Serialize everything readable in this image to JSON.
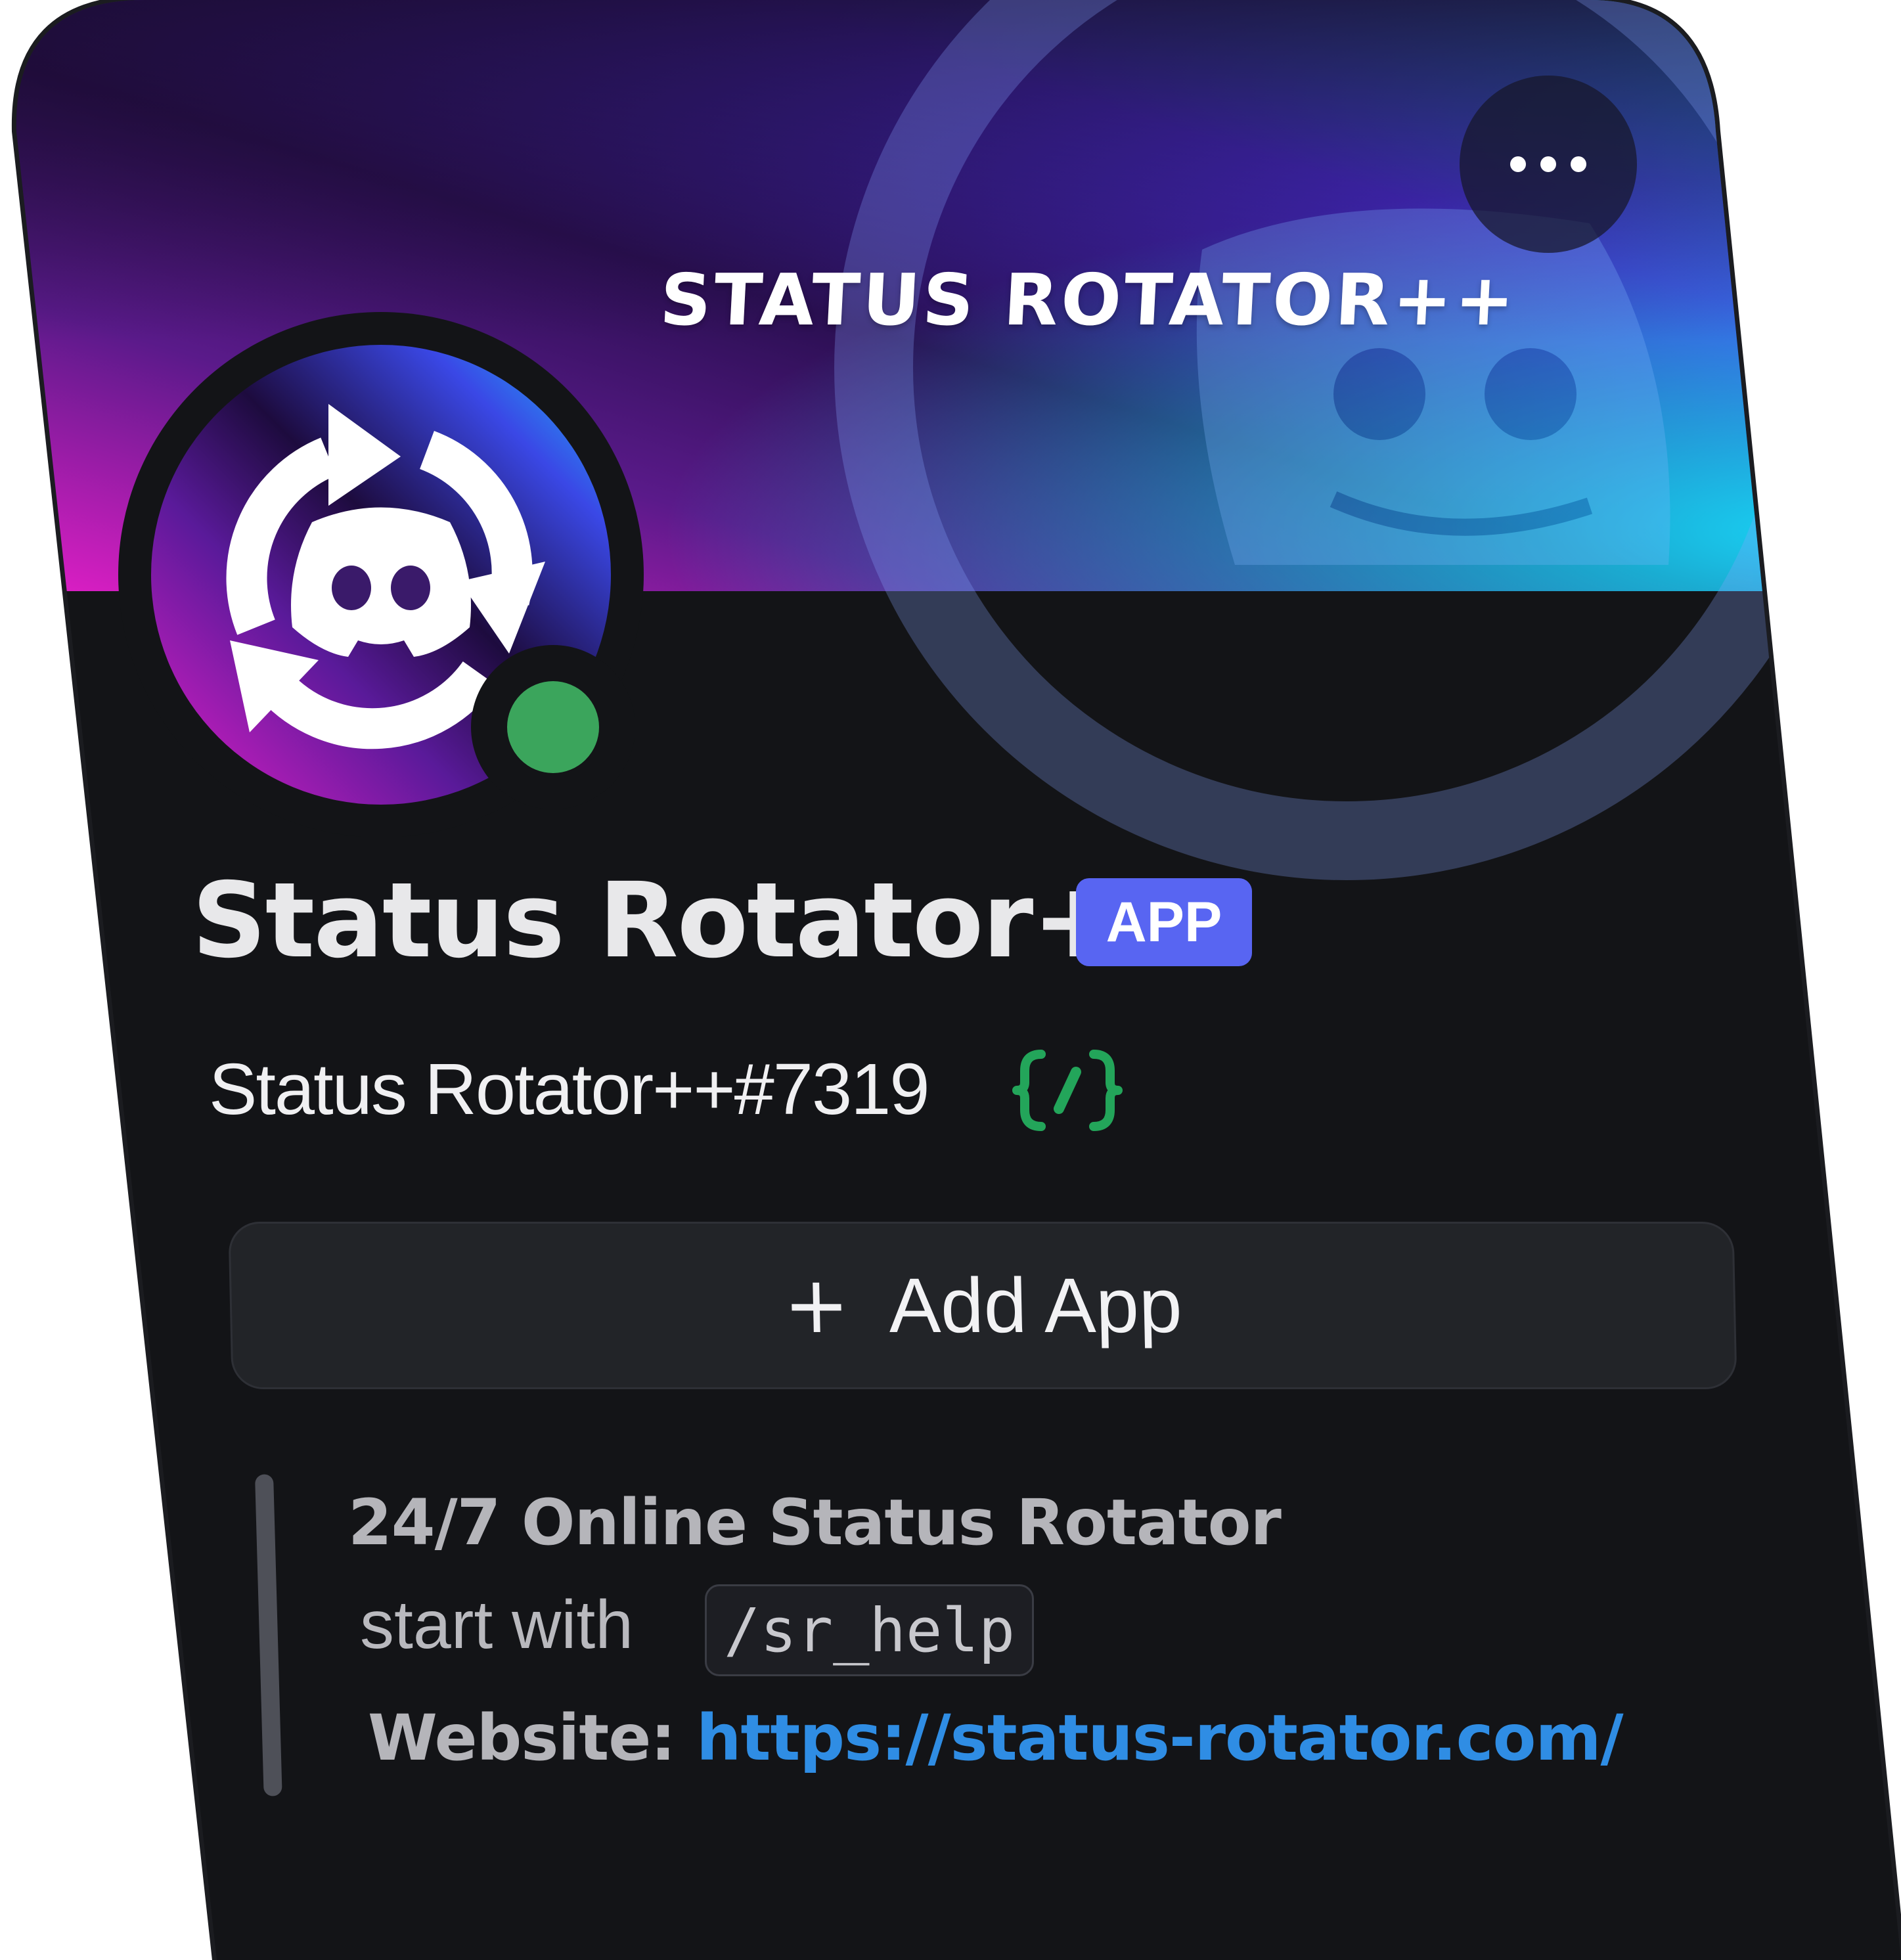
{
  "banner": {
    "title": "STATUS ROTATOR++",
    "gradient_colors": [
      "#1a0b2e",
      "#6a1fb0",
      "#d61fcf",
      "#3a4fe8",
      "#18d8f8"
    ]
  },
  "menu_button": {
    "icon": "more-horizontal-icon"
  },
  "avatar": {
    "icon": "rotator-discord-logo",
    "status": "online",
    "status_color": "#3ba55c"
  },
  "profile": {
    "display_name": "Status Rotator++",
    "badge": "APP",
    "badge_color": "#5865f2",
    "username": "Status Rotator++#7319",
    "command_icon": "slash-command-icon",
    "command_icon_color": "#23a55a"
  },
  "add_app": {
    "plus": "+",
    "label": "Add App"
  },
  "bio": {
    "title": "24/7 Online Status Rotator",
    "start_prefix": "start with",
    "command": "/sr_help",
    "website_label": "Website:",
    "website_url": "https://status-rotator.com/",
    "link_color": "#2f8de4"
  }
}
